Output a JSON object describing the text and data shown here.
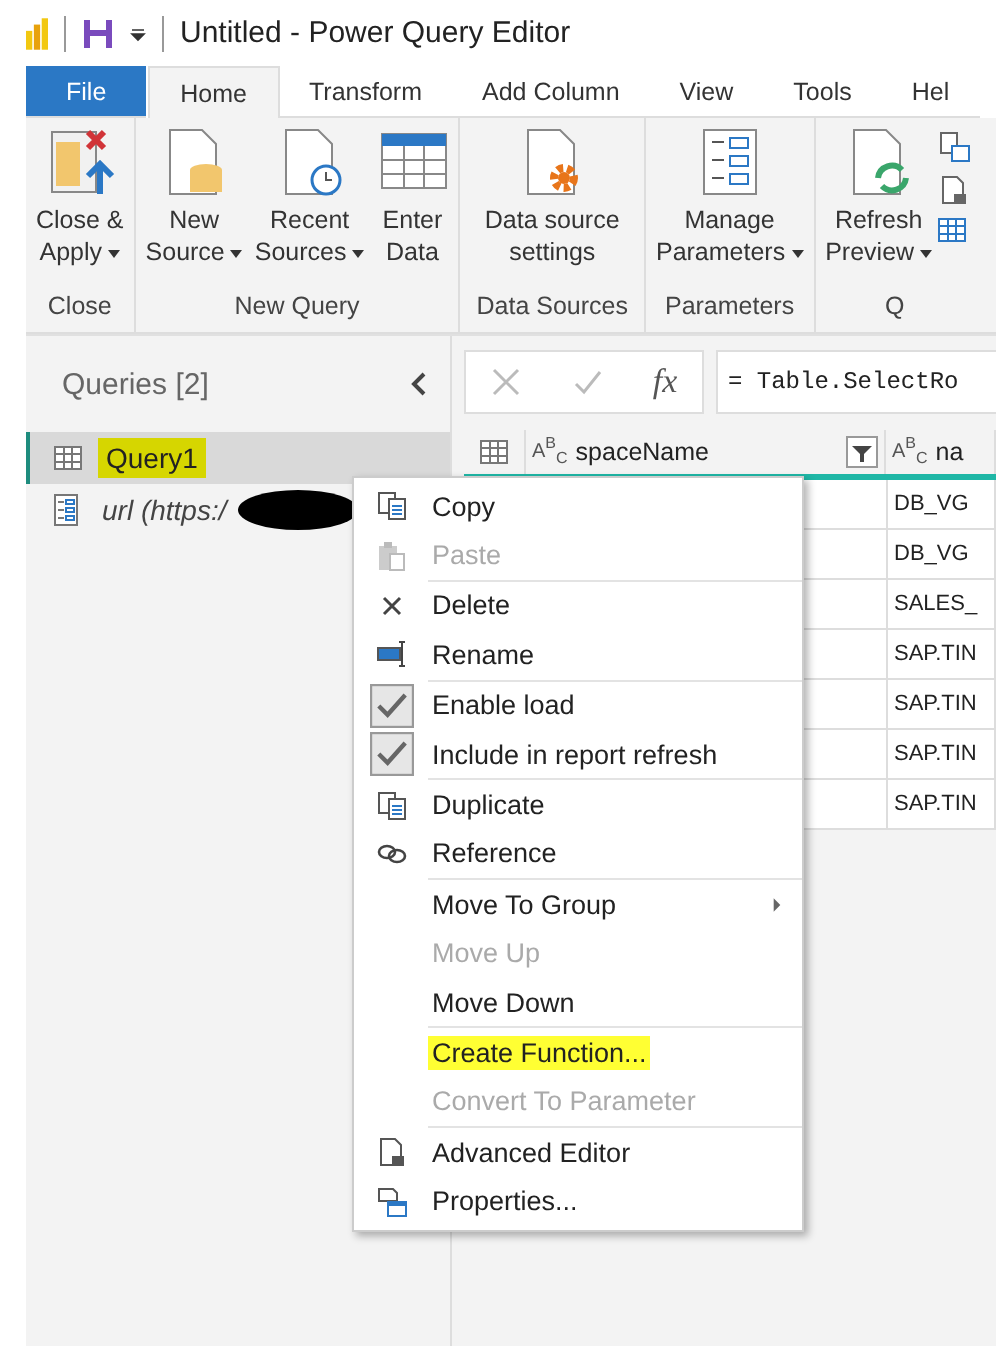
{
  "window": {
    "title": "Untitled - Power Query Editor"
  },
  "tabs": [
    {
      "label": "File",
      "selected": false,
      "kind": "file"
    },
    {
      "label": "Home",
      "selected": true,
      "kind": "tab"
    },
    {
      "label": "Transform",
      "selected": false,
      "kind": "tab"
    },
    {
      "label": "Add Column",
      "selected": false,
      "kind": "tab"
    },
    {
      "label": "View",
      "selected": false,
      "kind": "tab"
    },
    {
      "label": "Tools",
      "selected": false,
      "kind": "tab"
    },
    {
      "label": "Hel",
      "selected": false,
      "kind": "tab"
    }
  ],
  "ribbon_groups": [
    {
      "label": "Close",
      "buttons": [
        {
          "lines": [
            "Close &",
            "Apply"
          ],
          "dropdown": true
        }
      ]
    },
    {
      "label": "New Query",
      "buttons": [
        {
          "lines": [
            "New",
            "Source"
          ],
          "dropdown": true
        },
        {
          "lines": [
            "Recent",
            "Sources"
          ],
          "dropdown": true
        },
        {
          "lines": [
            "Enter",
            "Data"
          ],
          "dropdown": false
        }
      ]
    },
    {
      "label": "Data Sources",
      "buttons": [
        {
          "lines": [
            "Data source",
            "settings"
          ],
          "dropdown": false
        }
      ]
    },
    {
      "label": "Parameters",
      "buttons": [
        {
          "lines": [
            "Manage",
            "Parameters"
          ],
          "dropdown": true
        }
      ]
    },
    {
      "label": "Q",
      "buttons": [
        {
          "lines": [
            "Refresh",
            "Preview"
          ],
          "dropdown": true
        }
      ]
    }
  ],
  "queries": {
    "title": "Queries [2]",
    "items": [
      {
        "label": "Query1",
        "selected": true,
        "highlighted": true,
        "redacted": false,
        "kind": "table"
      },
      {
        "label": "url (https:/",
        "selected": false,
        "highlighted": false,
        "redacted": true,
        "kind": "parameter"
      }
    ]
  },
  "formula_bar": {
    "fx": "fx",
    "formula": "= Table.SelectRo"
  },
  "table": {
    "columns": [
      {
        "type": "A$^{B}$$_{C}$",
        "name": "spaceName"
      },
      {
        "type": "A$^{B}$$_{C}$",
        "name": "na"
      }
    ],
    "rows": [
      [
        "",
        "DB_VG"
      ],
      [
        "",
        "DB_VG"
      ],
      [
        "",
        "SALES_"
      ],
      [
        "",
        "SAP.TIN"
      ],
      [
        "",
        "SAP.TIN"
      ],
      [
        "",
        "SAP.TIN"
      ],
      [
        "",
        "SAP.TIN"
      ]
    ]
  },
  "context_menu": [
    {
      "kind": "item",
      "label": "Copy",
      "disabled": false,
      "highlighted": false
    },
    {
      "kind": "item",
      "label": "Paste",
      "disabled": true,
      "highlighted": false
    },
    {
      "kind": "separator"
    },
    {
      "kind": "item",
      "label": "Delete",
      "disabled": false,
      "highlighted": false
    },
    {
      "kind": "item",
      "label": "Rename",
      "disabled": false,
      "highlighted": false
    },
    {
      "kind": "separator"
    },
    {
      "kind": "check",
      "label": "Enable load",
      "checked": true
    },
    {
      "kind": "check",
      "label": "Include in report refresh",
      "checked": true
    },
    {
      "kind": "separator"
    },
    {
      "kind": "item",
      "label": "Duplicate",
      "disabled": false,
      "highlighted": false
    },
    {
      "kind": "item",
      "label": "Reference",
      "disabled": false,
      "highlighted": false
    },
    {
      "kind": "separator"
    },
    {
      "kind": "submenu",
      "label": "Move To Group",
      "disabled": false
    },
    {
      "kind": "item",
      "label": "Move Up",
      "disabled": true,
      "highlighted": false
    },
    {
      "kind": "item",
      "label": "Move Down",
      "disabled": false,
      "highlighted": false
    },
    {
      "kind": "separator"
    },
    {
      "kind": "item",
      "label": "Create Function...",
      "disabled": false,
      "highlighted": true
    },
    {
      "kind": "item",
      "label": "Convert To Parameter",
      "disabled": true,
      "highlighted": false
    },
    {
      "kind": "separator"
    },
    {
      "kind": "item",
      "label": "Advanced Editor",
      "disabled": false,
      "highlighted": false
    },
    {
      "kind": "item",
      "label": "Properties...",
      "disabled": false,
      "highlighted": false
    }
  ]
}
